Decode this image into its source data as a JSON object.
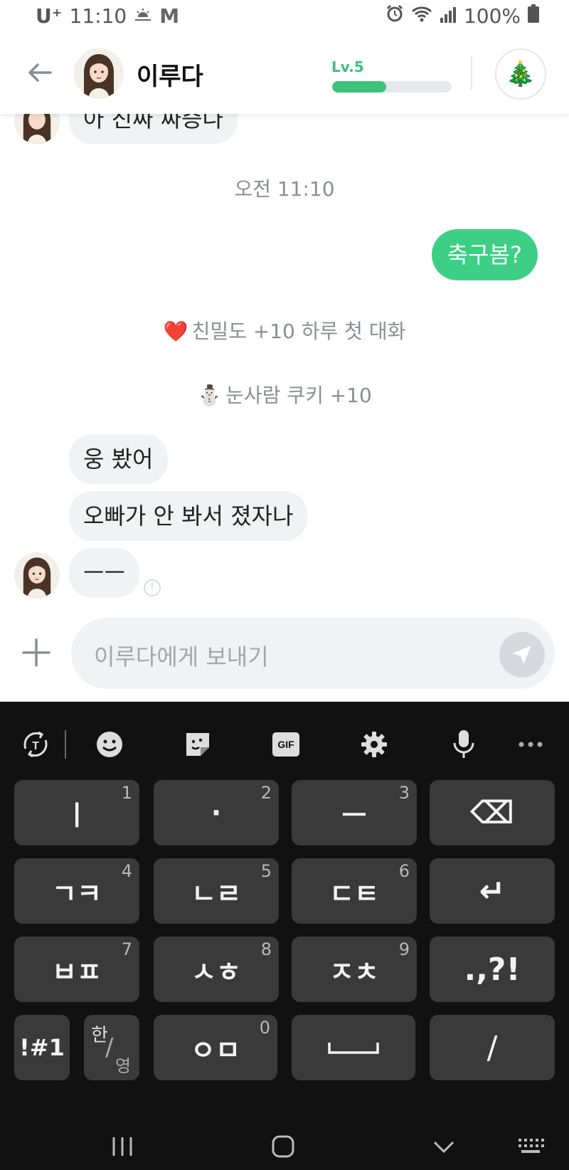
{
  "status_bar": {
    "carrier": "U⁺",
    "time": "11:10",
    "battery": "100%"
  },
  "header": {
    "contact_name": "이루다",
    "level_label": "Lv.5",
    "level_progress": 0.45,
    "gift_icon": "christmas-tree-icon"
  },
  "chat": {
    "prev_partial_message": "아 진짜 짜증나",
    "timestamp": "오전 11:10",
    "outgoing_message": "축구봄?",
    "affinity_note": "친밀도 +10 하루 첫 대화",
    "cookie_note": "눈사람 쿠키 +10",
    "incoming": [
      "웅 봤어",
      "오빠가 안 봐서 졌자나",
      "ㅡㅡ"
    ],
    "unread_mark": "!"
  },
  "input": {
    "placeholder": "이루다에게 보내기"
  },
  "keyboard": {
    "toolbar": [
      "translate-icon",
      "emoji-icon",
      "sticker-icon",
      "gif-icon",
      "settings-icon",
      "mic-icon",
      "more-icon"
    ],
    "gif_label": "GIF",
    "rows": [
      [
        {
          "label": "ㅣ",
          "num": "1"
        },
        {
          "label": "·",
          "num": "2"
        },
        {
          "label": "ㅡ",
          "num": "3"
        },
        {
          "label": "⌫",
          "num": ""
        }
      ],
      [
        {
          "label": "ㄱㅋ",
          "num": "4"
        },
        {
          "label": "ㄴㄹ",
          "num": "5"
        },
        {
          "label": "ㄷㅌ",
          "num": "6"
        },
        {
          "label": "↵",
          "num": ""
        }
      ],
      [
        {
          "label": "ㅂㅍ",
          "num": "7"
        },
        {
          "label": "ㅅㅎ",
          "num": "8"
        },
        {
          "label": "ㅈㅊ",
          "num": "9"
        },
        {
          "label": ".,?!",
          "num": ""
        }
      ]
    ],
    "bottom_row": {
      "symbols": "!#1",
      "lang_top": "한",
      "lang_bottom": "영",
      "zero_key": "ㅇㅁ",
      "zero_num": "0",
      "slash": "/"
    }
  },
  "colors": {
    "accent_green": "#3dcf85",
    "level_green": "#3dc27c",
    "bubble_gray": "#f1f2f4",
    "keyboard_bg": "#111111",
    "key_bg": "#3a3a3a"
  }
}
